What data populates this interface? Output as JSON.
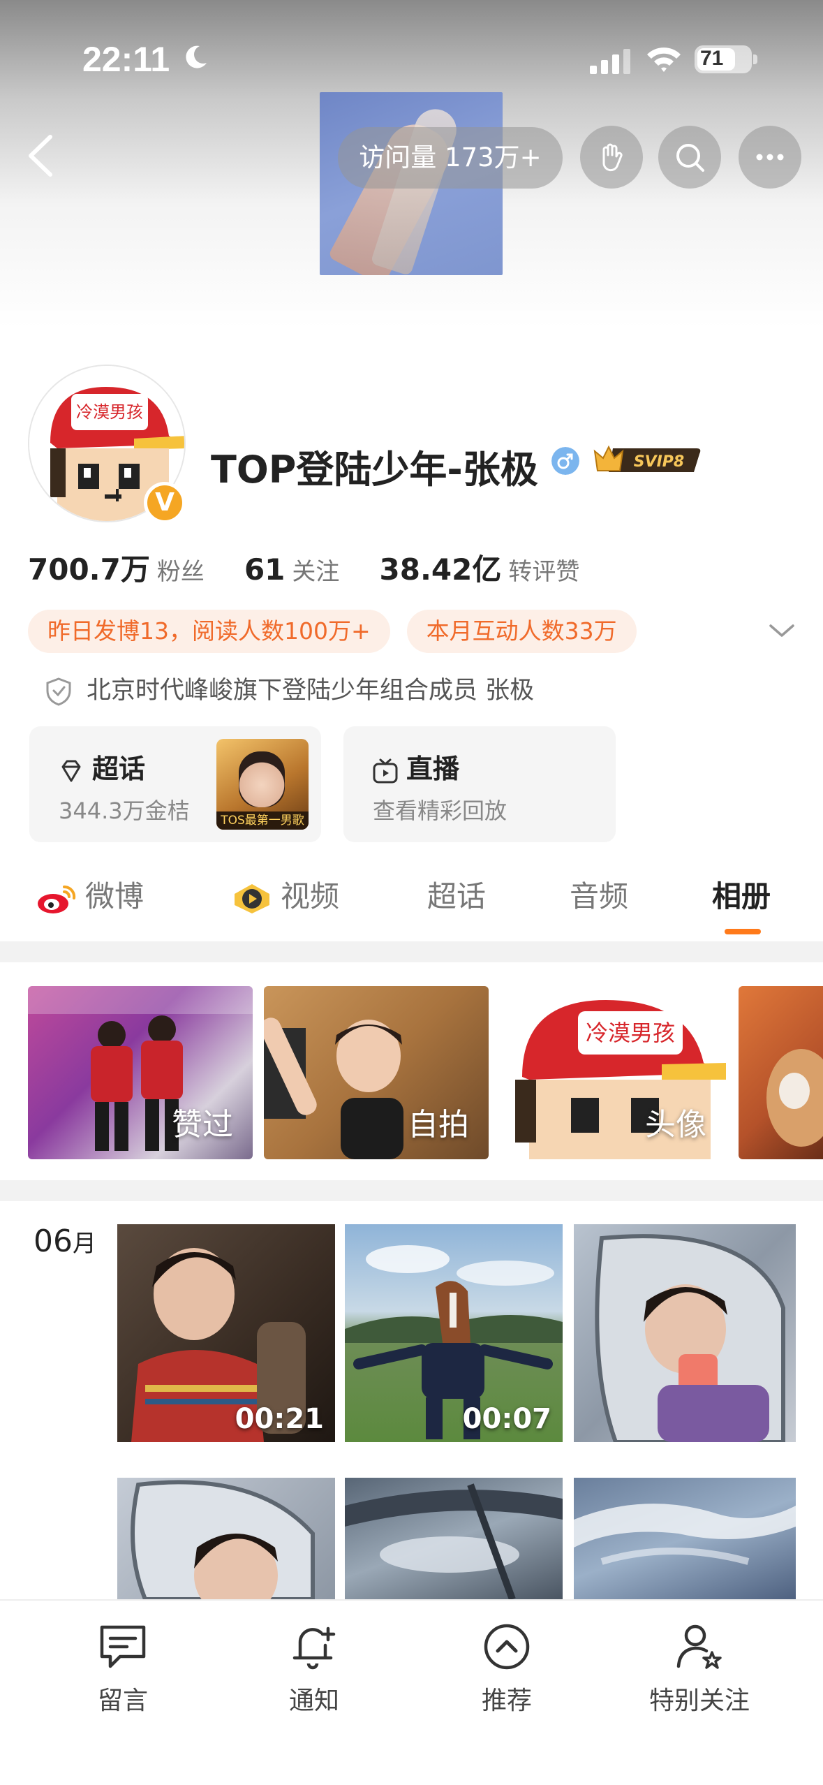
{
  "status_bar": {
    "time": "22:11",
    "battery": "71"
  },
  "header": {
    "visit_label": "访问量 173万+"
  },
  "profile": {
    "username": "TOP登陆少年-张极",
    "avatar_text": "冷漠男孩",
    "verify_mark": "V",
    "vip_label": "SVIP8",
    "stats": [
      {
        "value": "700.7万",
        "label": "粉丝"
      },
      {
        "value": "61",
        "label": "关注"
      },
      {
        "value": "38.42亿",
        "label": "转评赞"
      }
    ],
    "pills": [
      "昨日发博13，阅读人数100万+",
      "本月互动人数33万"
    ],
    "bio": "北京时代峰峻旗下登陆少年组合成员 张极"
  },
  "cards": {
    "chaohua": {
      "title": "超话",
      "sub": "344.3万金桔",
      "thumb_caption": "TOS最第一男歌手"
    },
    "live": {
      "title": "直播",
      "sub": "查看精彩回放"
    }
  },
  "tabs": [
    "微博",
    "视频",
    "超话",
    "音频",
    "相册"
  ],
  "album_categories": [
    "赞过",
    "自拍",
    "头像"
  ],
  "month": {
    "num": "06",
    "unit": "月"
  },
  "video_durations": [
    "00:21",
    "00:07"
  ],
  "bottom_bar": [
    "留言",
    "通知",
    "推荐",
    "特别关注"
  ],
  "colors": {
    "accent": "#ff7a1a",
    "pill_bg": "#fdefe7",
    "pill_text": "#f06a2a"
  }
}
